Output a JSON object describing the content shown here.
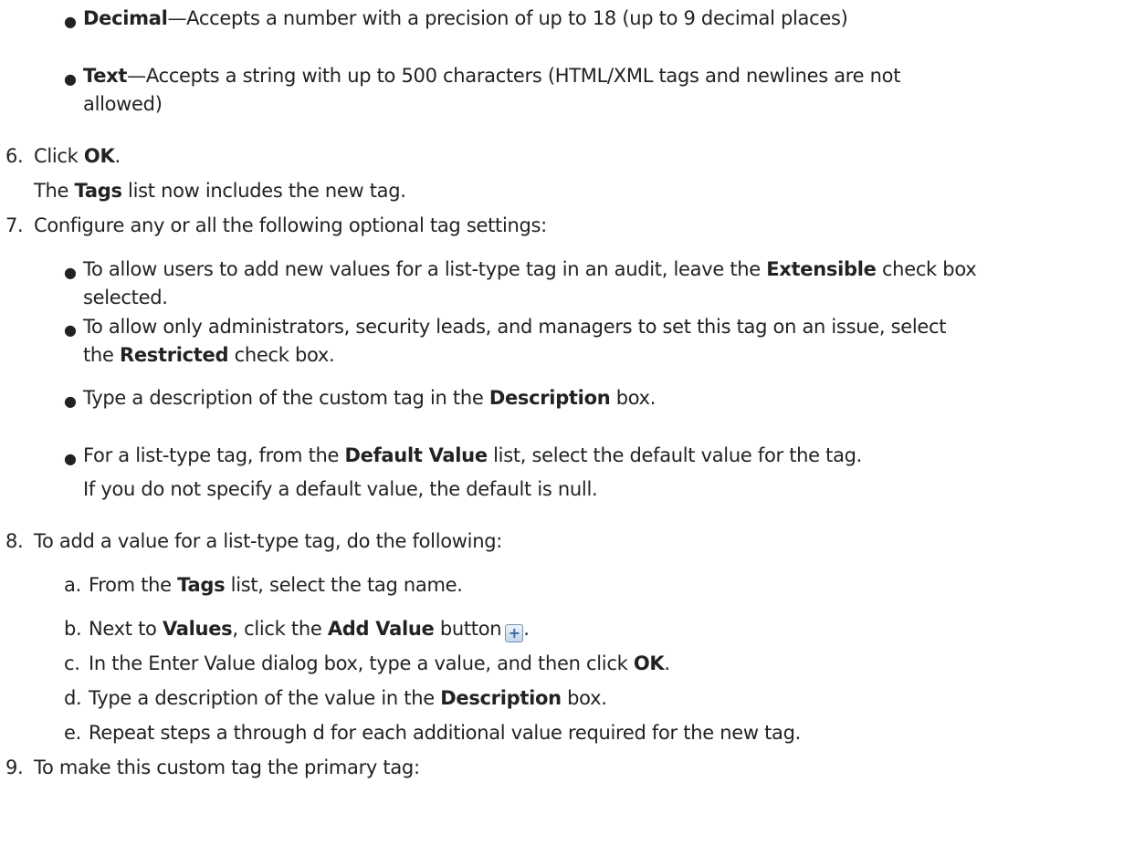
{
  "types": {
    "decimal": {
      "name": "Decimal",
      "desc": "—Accepts a number with a precision of up to 18 (up to 9 decimal places)"
    },
    "text": {
      "name": "Text",
      "desc_line1": "—Accepts a string with up to 500 characters (HTML/XML tags and newlines are not",
      "desc_line2": "allowed)"
    }
  },
  "step6": {
    "num": "6.",
    "pre": "Click ",
    "bold": "OK",
    "post": ".",
    "note_pre": "The ",
    "note_bold": "Tags",
    "note_post": " list now includes the new tag."
  },
  "step7": {
    "num": "7.",
    "text": "Configure any or all the following optional tag settings:",
    "b1_pre": "To allow users to add new values for a list-type tag in an audit, leave the ",
    "b1_bold": "Extensible",
    "b1_post": " check box",
    "b1_line2": "selected.",
    "b2_line1": "To allow only administrators, security leads, and managers to set this tag on an issue, select",
    "b2_pre": "the ",
    "b2_bold": "Restricted",
    "b2_post": " check box.",
    "b3_pre": "Type a description of the custom tag in the ",
    "b3_bold": "Description",
    "b3_post": " box.",
    "b4_pre": "For a list-type tag, from the ",
    "b4_bold": "Default Value",
    "b4_post": " list, select the default value for the tag.",
    "b4_note": "If you do not specify a default value, the default is null."
  },
  "step8": {
    "num": "8.",
    "text": "To add a value for a list-type tag, do the following:",
    "a_label": "a.",
    "a_pre": "From the ",
    "a_bold": "Tags",
    "a_post": " list, select the tag name.",
    "b_label": "b.",
    "b_pre": "Next to ",
    "b_bold1": "Values",
    "b_mid": ", click the ",
    "b_bold2": "Add Value",
    "b_post": " button",
    "b_end": ".",
    "b_icon": "add-value-icon",
    "c_label": "c.",
    "c_pre": "In the Enter Value dialog box, type a value, and then click ",
    "c_bold": "OK",
    "c_post": ".",
    "d_label": "d.",
    "d_pre": "Type a description of the value in the ",
    "d_bold": "Description",
    "d_post": " box.",
    "e_label": "e.",
    "e_text": "Repeat steps a through d for each additional value required for the new tag."
  },
  "step9": {
    "num": "9.",
    "text": "To make this custom tag the primary tag:"
  }
}
